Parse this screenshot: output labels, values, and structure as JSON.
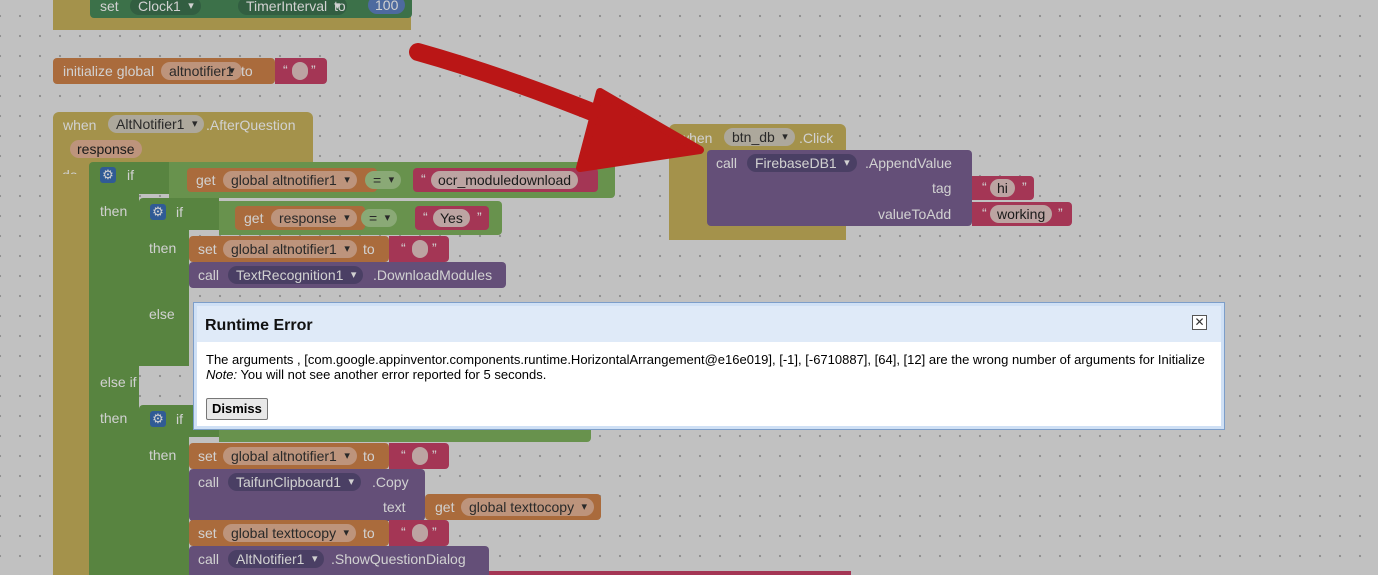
{
  "blocks": {
    "top_set": {
      "set": "set",
      "component": "Clock1",
      "property": "TimerInterval",
      "to": "to",
      "value": "100"
    },
    "init_global": {
      "label": "initialize global",
      "name": "altnotifier1",
      "to": "to",
      "value": ""
    },
    "when_after": {
      "when": "when",
      "component": "AltNotifier1",
      "event": ".AfterQuestion",
      "param": "response",
      "do": "do",
      "if": "if",
      "then": "then",
      "else": "else",
      "else_if": "else if",
      "get": "get",
      "eq": "=",
      "var1": "global altnotifier1",
      "str1": "ocr_moduledownload",
      "var2": "response",
      "str2": "Yes",
      "set": "set",
      "to": "to",
      "set_var": "global altnotifier1",
      "set_val": "",
      "call": "call",
      "tr_comp": "TextRecognition1",
      "tr_method": ".DownloadModules",
      "clip_comp": "TaifunClipboard1",
      "clip_method": ".Copy",
      "text_label": "text",
      "copy_var": "global texttocopy",
      "set_var2": "global texttocopy",
      "set_val2": "",
      "alt_comp": "AltNotifier1",
      "alt_method": ".ShowQuestionDialog"
    },
    "when_click": {
      "when": "when",
      "component": "btn_db",
      "event": ".Click",
      "call": "call",
      "fb_comp": "FirebaseDB1",
      "fb_method": ".AppendValue",
      "tag": "tag",
      "tag_val": "hi",
      "value_to_add": "valueToAdd",
      "value_val": "working"
    }
  },
  "dialog": {
    "title": "Runtime Error",
    "message": "The arguments , [com.google.appinventor.components.runtime.HorizontalArrangement@e16e019], [-1], [-6710887], [64], [12] are the wrong number of arguments for Initialize",
    "note_label": "Note:",
    "note_text": " You will not see another error reported for 5 seconds.",
    "dismiss": "Dismiss",
    "close": "✕"
  },
  "colors": {
    "event": "#c8b35c",
    "logic_var": "#d0834a",
    "text": "#c84268",
    "control": "#6ca24f",
    "component": "#7a6193",
    "set_block": "#4a8a5a",
    "arrow": "#e31b1b"
  },
  "icons": {
    "gear": "gear-icon",
    "close": "close-icon",
    "arrow": "red-arrow-annotation"
  }
}
